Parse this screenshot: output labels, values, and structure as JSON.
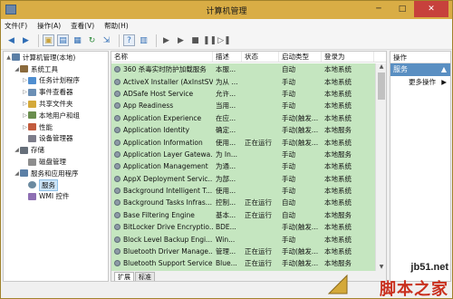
{
  "window": {
    "title": "计算机管理"
  },
  "menu": [
    "文件(F)",
    "操作(A)",
    "查看(V)",
    "帮助(H)"
  ],
  "tree": [
    {
      "label": "计算机管理(本地)",
      "level": 0,
      "arrow": "▲",
      "icon": "computer-icon"
    },
    {
      "label": "系统工具",
      "level": 1,
      "arrow": "◢",
      "icon": "tools-icon"
    },
    {
      "label": "任务计划程序",
      "level": 2,
      "arrow": "▷",
      "icon": "task-scheduler-icon"
    },
    {
      "label": "事件查看器",
      "level": 2,
      "arrow": "▷",
      "icon": "event-viewer-icon"
    },
    {
      "label": "共享文件夹",
      "level": 2,
      "arrow": "▷",
      "icon": "shared-folder-icon"
    },
    {
      "label": "本地用户和组",
      "level": 2,
      "arrow": "▷",
      "icon": "users-icon"
    },
    {
      "label": "性能",
      "level": 2,
      "arrow": "▷",
      "icon": "performance-icon"
    },
    {
      "label": "设备管理器",
      "level": 2,
      "arrow": "",
      "icon": "device-manager-icon"
    },
    {
      "label": "存储",
      "level": 1,
      "arrow": "◢",
      "icon": "storage-icon"
    },
    {
      "label": "磁盘管理",
      "level": 2,
      "arrow": "",
      "icon": "disk-icon"
    },
    {
      "label": "服务和应用程序",
      "level": 1,
      "arrow": "◢",
      "icon": "apps-icon"
    },
    {
      "label": "服务",
      "level": 2,
      "arrow": "",
      "icon": "services-icon",
      "selected": true
    },
    {
      "label": "WMI 控件",
      "level": 2,
      "arrow": "",
      "icon": "wmi-icon"
    }
  ],
  "columns": [
    "名称",
    "描述",
    "状态",
    "启动类型",
    "登录为"
  ],
  "services": [
    [
      "360 杀毒实时防护加载服务",
      "本服...",
      "",
      "自动",
      "本地系统"
    ],
    [
      "ActiveX Installer (AxInstSV)",
      "为从 ...",
      "",
      "手动",
      "本地系统"
    ],
    [
      "ADSafe Host Service",
      "允许...",
      "",
      "手动",
      "本地系统"
    ],
    [
      "App Readiness",
      "当用...",
      "",
      "手动",
      "本地系统"
    ],
    [
      "Application Experience",
      "在应...",
      "",
      "手动(触发...",
      "本地系统"
    ],
    [
      "Application Identity",
      "确定...",
      "",
      "手动(触发...",
      "本地服务"
    ],
    [
      "Application Information",
      "使用...",
      "正在运行",
      "手动(触发...",
      "本地系统"
    ],
    [
      "Application Layer Gatewa...",
      "为 In...",
      "",
      "手动",
      "本地服务"
    ],
    [
      "Application Management",
      "为通...",
      "",
      "手动",
      "本地系统"
    ],
    [
      "AppX Deployment Servic...",
      "为部...",
      "",
      "手动",
      "本地系统"
    ],
    [
      "Background Intelligent T...",
      "使用...",
      "",
      "手动",
      "本地系统"
    ],
    [
      "Background Tasks Infras...",
      "控制...",
      "正在运行",
      "自动",
      "本地系统"
    ],
    [
      "Base Filtering Engine",
      "基本...",
      "正在运行",
      "自动",
      "本地服务"
    ],
    [
      "BitLocker Drive Encryptio...",
      "BDE...",
      "",
      "手动(触发...",
      "本地系统"
    ],
    [
      "Block Level Backup Engi...",
      "Win...",
      "",
      "手动",
      "本地系统"
    ],
    [
      "Bluetooth Driver Manage...",
      "管理...",
      "正在运行",
      "手动(触发...",
      "本地系统"
    ],
    [
      "Bluetooth Support Service",
      "Blue...",
      "正在运行",
      "手动(触发...",
      "本地服务"
    ]
  ],
  "tabs": [
    "扩展",
    "标准"
  ],
  "actions": {
    "title": "操作",
    "section": "服务",
    "more": "更多操作"
  },
  "watermark": {
    "url": "jb51.net",
    "site": "脚本之家"
  }
}
